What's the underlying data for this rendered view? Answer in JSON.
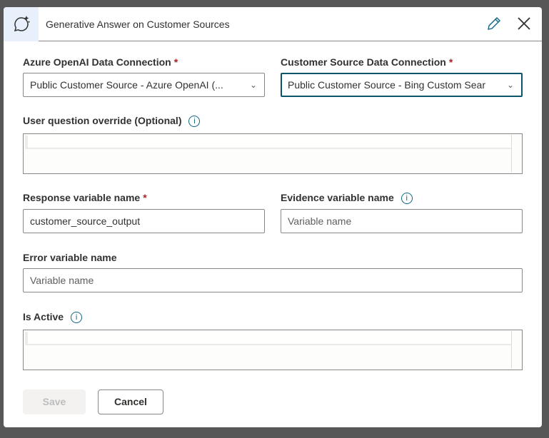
{
  "dialog": {
    "title": "Generative Answer on Customer Sources",
    "icon": "chat-sparkle-icon"
  },
  "fields": {
    "azure_openai": {
      "label": "Azure OpenAI Data Connection",
      "required": "*",
      "value": "Public Customer Source - Azure OpenAI (..."
    },
    "customer_source": {
      "label": "Customer Source Data Connection",
      "required": "*",
      "value": "Public Customer Source - Bing Custom Sear"
    },
    "user_question": {
      "label": "User question override (Optional)",
      "info": "i"
    },
    "response_var": {
      "label": "Response variable name",
      "required": "*",
      "value": "customer_source_output"
    },
    "evidence_var": {
      "label": "Evidence variable name",
      "info": "i",
      "placeholder": "Variable name"
    },
    "error_var": {
      "label": "Error variable name",
      "placeholder": "Variable name"
    },
    "is_active": {
      "label": "Is Active",
      "info": "i"
    }
  },
  "buttons": {
    "save": "Save",
    "cancel": "Cancel"
  },
  "colors": {
    "accent": "#0b556a",
    "required": "#a4262c",
    "header_icon_bg": "#e8f1fb"
  }
}
